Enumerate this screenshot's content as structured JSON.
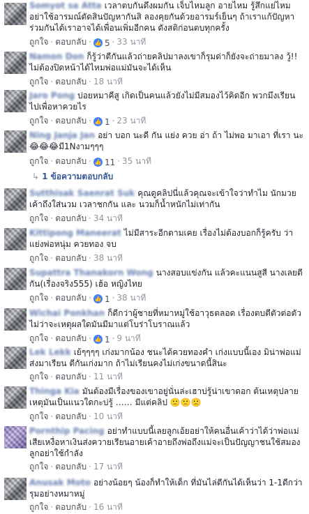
{
  "actions": {
    "like": "ถูกใจ",
    "reply": "ตอบกลับ"
  },
  "comments": [
    {
      "author": "Somyot sa Atta",
      "text": "เวลาตบกันดึงผมกัน เจ็บไหมลูก อายไหม รู้สึกแย่ไหม อย่าใช้อารมณ์ตัดสินปัญหากันสิ ลองคุยกันด้วยอารมร์เย็นๆ ถ้าเราแก้ปัญหาร่วมกันได้เราอาจได้เพื่อนเพิ่มอีกคน ดังสติก่อนตบทุกครั้ง",
      "likes": "5",
      "time": "33 นาที"
    },
    {
      "author": "Namon Don",
      "text": "ก็รู้ว่าตีกันแล้วถ่ายคลิปมาลงเขาก็รุมด่าก็ยังจะถ่ายมาลง วู้!! ไม่ต้องปิดหน้าได้ไหมพ่อแม่มันจะได้เห็น",
      "likes": "",
      "time": "18 นาที"
    },
    {
      "author": "Jaro Pong",
      "text": "บ่อยหมาคีสู เกิดเป็นคนแล้วยังไม่มีสมองไว้คิดอีก พวกมึงเรียนไปเพื่อหาควยไร",
      "likes": "1",
      "time": "23 นาที"
    },
    {
      "author": "Ning Janja Jan",
      "text": "อย่า บอก นะดี กัน แย่ง ควย อ่า ถ้า ไม่พอ มาเอา ที่เรา นะ😂😂😂มี1Nงามๆๆๆ",
      "likes": "11",
      "time": "35 นาที"
    },
    {
      "author": "Sutthisak Saenrat Suk",
      "text": "คุณดูคลิปนี่แล้วคุณจะเข้าใจว่าทำไม นักมวยเค้าถึงใส่นวม เวลาชกกัน และ นวมก็น้ำหนักไม่เท่ากัน",
      "likes": "",
      "time": "34 นาที"
    },
    {
      "author": "Kittipong Maneerat",
      "text": "ไม่มีสาระอีกตามเคย เรื่องไม่ต้องบอกก็รู้ครับ ว่าแย่งพ่อหนุ่ม ควยทอง จบ",
      "likes": "",
      "time": "38 นาที"
    },
    {
      "author": "Supattra Thanakorn Wong",
      "text": "นางสอบแข่งกัน แล้วคะแนนสูสี นางเลยตีกัน(เรื่องจริง555) เฮ้อ หญิงไทย",
      "likes": "1",
      "time": "38 นาที"
    },
    {
      "author": "Wichai Ponkhan",
      "text": "ก็ดีกว่าผู้ชายที่หมาหมู่ใช้อาวุธตลอด เรื่องตบตีตัวต่อตัวไม่ว่าจะเหตุผลใดมันมีมาแต่โบร่าโบราณแล้ว",
      "likes": "1",
      "time": "9 นาที"
    },
    {
      "author": "Lek Lekk",
      "text": "เย้ๆๆๆๆ เก่งมากน้อง ชนะได้ควยทองคำ เก่งแบบนี้เอง มิน่าพ่อแม่ส่งมาเรียน ตีกันเก่งมาก ถ้าไม่เรียนคงไม่เก่งขนาดนี้สินะ",
      "likes": "",
      "time": "11 นาที"
    },
    {
      "author": "Thinga Kia",
      "text": "มันต้องมีเรื่องของเขาอยู่นั่นล่ะเฮาบ่รู้น่าเขาดอก ต้นเหตุปลายเหตุมันเป็นแนวใดกะบ่รู้ …… มีแต่คลิป 🙁🙁🙁",
      "likes": "",
      "time": "10 นาที"
    },
    {
      "author": "Pornthip Pacing",
      "text": "อย่าทำแบบนี้เลยลูกเอ้ยอย่าให้คนอื่นเค้าว่าได้ว่าพ่อแม่เสียเหงื่อหาเงินส่งควายเรียนอายเค้าอายถึงพ่อถึงแม่จะเป็นปัญญาชนใช้สมองลูกอย่าใช้กำลัง",
      "likes": "",
      "time": "17 นาที"
    },
    {
      "author": "Anusak Moto",
      "text": "อย่างน้อยๆ น้องก็ทำให้เด็ก ที่มันไล่ตีกันได้เห็นว่า 1-1ดีกว่ารุมอย่างหมาหมู่",
      "likes": "",
      "time": "16 นาที"
    }
  ],
  "reply_thread": {
    "label": "1 ข้อความตอบกลับ"
  }
}
